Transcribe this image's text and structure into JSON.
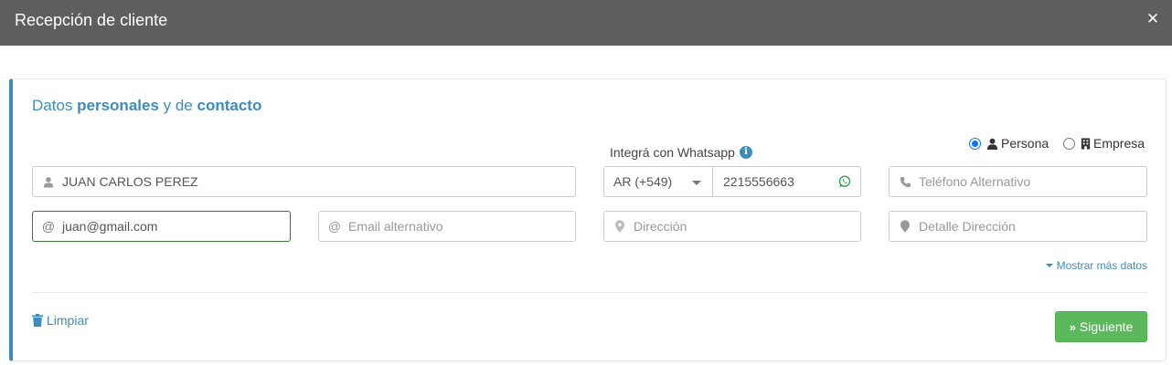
{
  "header": {
    "title": "Recepción de cliente",
    "close_glyph": "✕"
  },
  "section": {
    "title_1": "Datos ",
    "title_2": "personales",
    "title_3": " y de ",
    "title_4": "contacto"
  },
  "whatsapp": {
    "label": "Integrá con Whatsapp",
    "info_glyph": "i"
  },
  "client_type": {
    "options": [
      {
        "label": "Persona",
        "checked": true,
        "icon": "user-icon"
      },
      {
        "label": "Empresa",
        "checked": false,
        "icon": "building-icon"
      }
    ]
  },
  "fields": {
    "name": {
      "value": "JUAN CARLOS PEREZ",
      "icon": "user-icon"
    },
    "country_code": {
      "value": "AR (+549)"
    },
    "phone": {
      "value": "2215556663",
      "icon": "whatsapp-icon"
    },
    "alt_phone": {
      "placeholder": "Teléfono Alternativo",
      "icon": "phone-icon"
    },
    "email": {
      "value": "juan@gmail.com",
      "icon": "at-icon",
      "at": "@"
    },
    "alt_email": {
      "placeholder": "Email alternativo",
      "icon": "at-icon",
      "at": "@"
    },
    "address": {
      "placeholder": "Dirección",
      "icon": "map-marker-icon"
    },
    "address_detail": {
      "placeholder": "Detalle Dirección",
      "icon": "map-marker-icon"
    }
  },
  "links": {
    "more": "Mostrar más datos",
    "clear": "Limpiar"
  },
  "buttons": {
    "next": "Siguiente",
    "next_glyph": "»"
  },
  "colors": {
    "header": "#5e5e5e",
    "accent": "#3c8dbc",
    "success": "#5cb85c",
    "whatsapp": "#25a244"
  }
}
